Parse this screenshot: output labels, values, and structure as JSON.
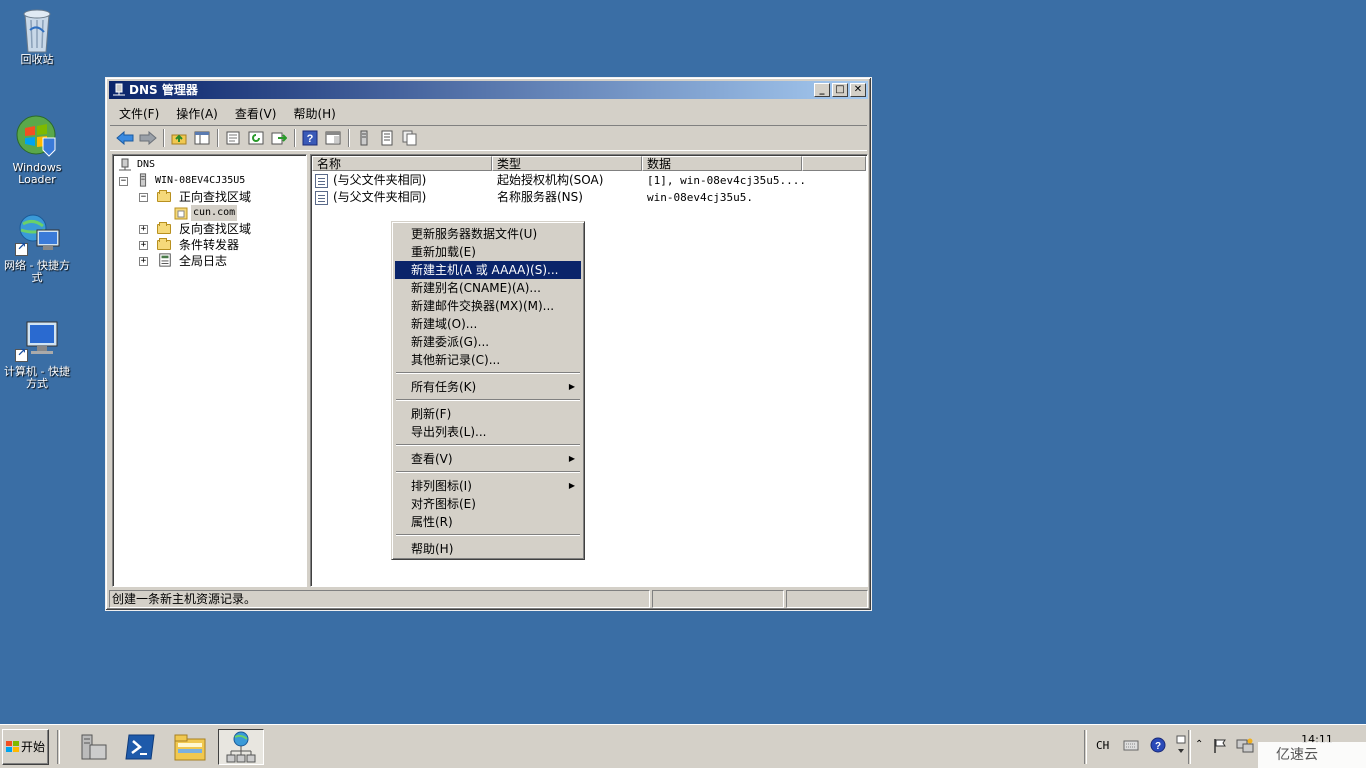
{
  "desktop": {
    "icons": [
      {
        "label": "回收站"
      },
      {
        "label": "Windows Loader"
      },
      {
        "label": "网络 - 快捷方式"
      },
      {
        "label": "计算机 - 快捷方式"
      }
    ]
  },
  "window": {
    "title": "DNS 管理器",
    "controls": {
      "minimize": "_",
      "maximize": "□",
      "close": "✕"
    },
    "menu": [
      "文件(F)",
      "操作(A)",
      "查看(V)",
      "帮助(H)"
    ],
    "tree": {
      "root": "DNS",
      "server": "WIN-08EV4CJ35U5",
      "forward_zone": "正向查找区域",
      "zone": "cun.com",
      "reverse_zone": "反向查找区域",
      "conditional_forwarders": "条件转发器",
      "global_logs": "全局日志"
    },
    "list": {
      "columns": [
        "名称",
        "类型",
        "数据"
      ],
      "rows": [
        {
          "name": "(与父文件夹相同)",
          "type": "起始授权机构(SOA)",
          "data": "[1], win-08ev4cj35u5...."
        },
        {
          "name": "(与父文件夹相同)",
          "type": "名称服务器(NS)",
          "data": "win-08ev4cj35u5."
        }
      ]
    },
    "status": "创建一条新主机资源记录。"
  },
  "context_menu": {
    "items": [
      {
        "label": "更新服务器数据文件(U)"
      },
      {
        "label": "重新加载(E)"
      },
      {
        "label": "新建主机(A 或 AAAA)(S)...",
        "highlighted": true
      },
      {
        "label": "新建别名(CNAME)(A)..."
      },
      {
        "label": "新建邮件交换器(MX)(M)..."
      },
      {
        "label": "新建域(O)..."
      },
      {
        "label": "新建委派(G)..."
      },
      {
        "label": "其他新记录(C)..."
      },
      {
        "label": "所有任务(K)",
        "submenu": true
      },
      {
        "label": "刷新(F)"
      },
      {
        "label": "导出列表(L)..."
      },
      {
        "label": "查看(V)",
        "submenu": true
      },
      {
        "label": "排列图标(I)",
        "submenu": true
      },
      {
        "label": "对齐图标(E)"
      },
      {
        "label": "属性(R)"
      },
      {
        "label": "帮助(H)"
      }
    ]
  },
  "taskbar": {
    "start_label": "开始",
    "tray_lang": "CH",
    "clock": "14:11",
    "watermark": "亿速云"
  },
  "colors": {
    "desktop": "#3a6ea5",
    "highlight": "#0a246a",
    "chrome": "#d4d0c8"
  }
}
